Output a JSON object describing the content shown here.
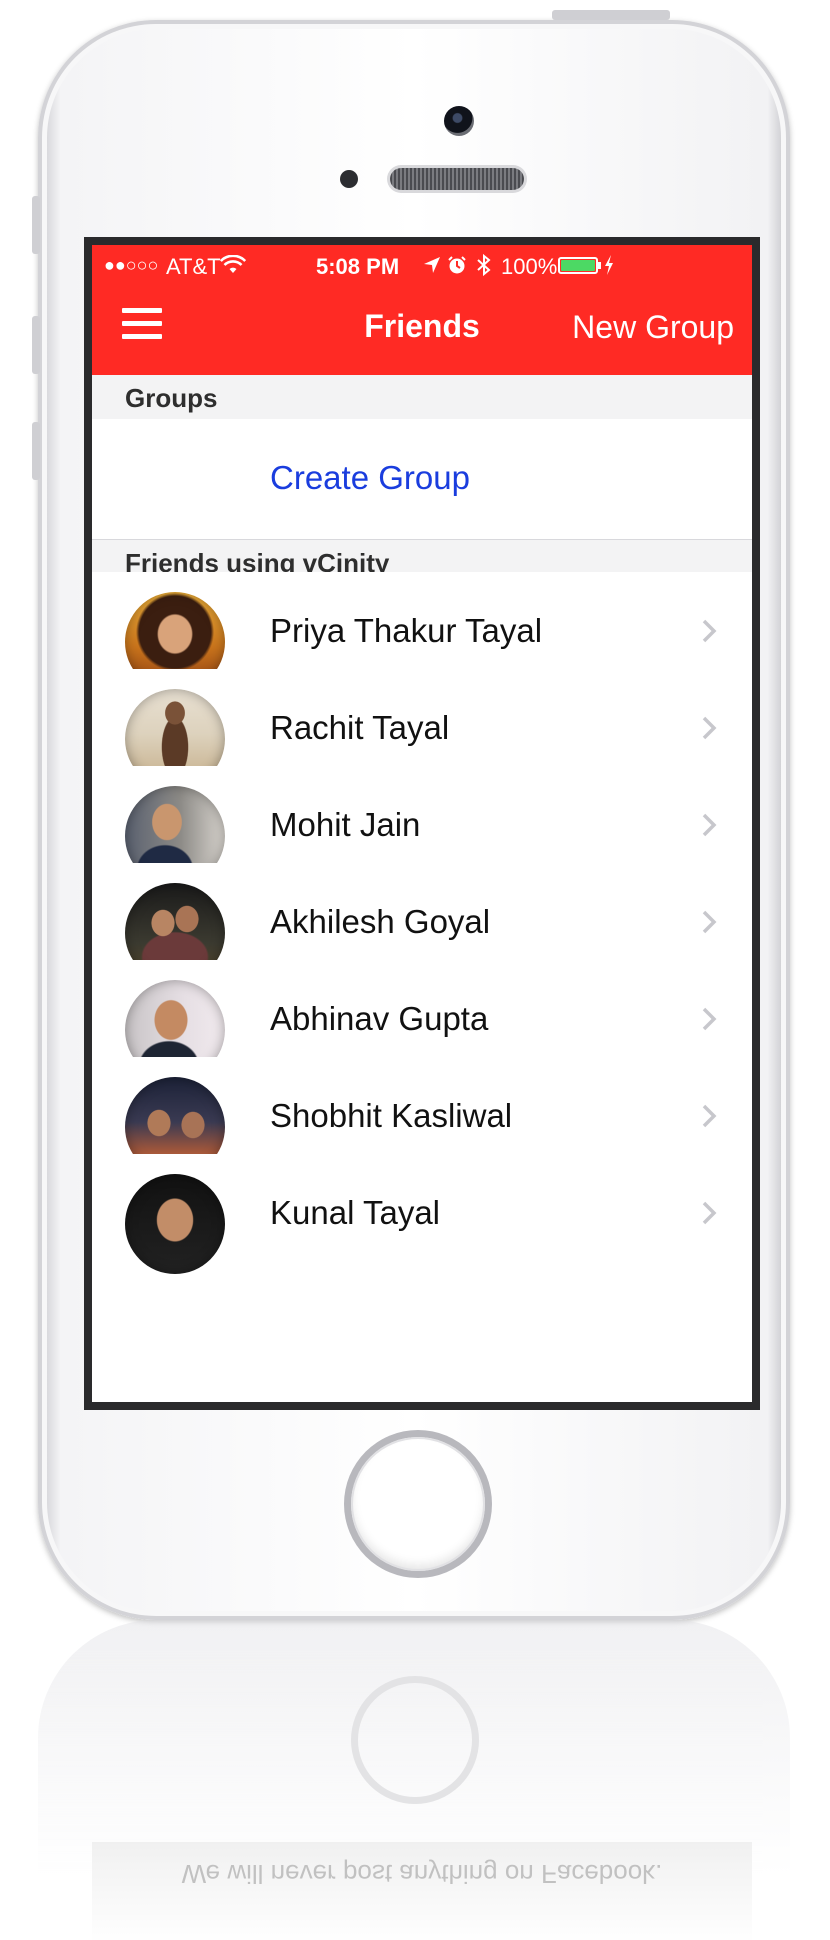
{
  "status_bar": {
    "carrier": "AT&T",
    "signal_dots": "●●○○○",
    "time": "5:08 PM",
    "battery": "100%"
  },
  "nav_bar": {
    "title": "Friends",
    "right_button": "New Group"
  },
  "groups_section": {
    "header": "Groups",
    "create_label": "Create Group"
  },
  "friends_section": {
    "header": "Friends using vCinity",
    "items": [
      {
        "name": "Priya Thakur Tayal"
      },
      {
        "name": "Rachit Tayal"
      },
      {
        "name": "Mohit Jain"
      },
      {
        "name": "Akhilesh Goyal"
      },
      {
        "name": "Abhinav Gupta"
      },
      {
        "name": "Shobhit Kasliwal"
      },
      {
        "name": "Kunal Tayal"
      }
    ]
  },
  "reflection": {
    "text": "We will never post anything on Facebook."
  },
  "colors": {
    "accent": "#ff2a24",
    "link": "#1a3dde",
    "section_bg": "#f3f3f4"
  }
}
